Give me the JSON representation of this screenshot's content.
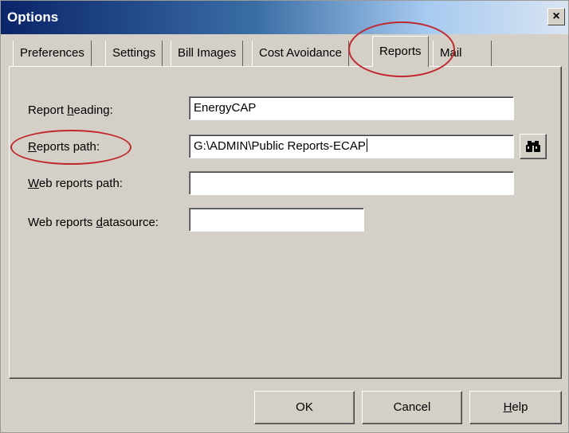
{
  "window": {
    "title": "Options",
    "close_glyph": "×"
  },
  "tabs": [
    {
      "label": "Preferences",
      "active": false
    },
    {
      "label": "Settings",
      "active": false
    },
    {
      "label": "Bill Images",
      "active": false
    },
    {
      "label": "Cost Avoidance",
      "active": false
    },
    {
      "label": "Reports",
      "active": true
    },
    {
      "label": "Mail",
      "active": false
    }
  ],
  "form": {
    "report_heading": {
      "label_pre": "Report ",
      "label_key": "h",
      "label_post": "eading:",
      "value": "EnergyCAP"
    },
    "reports_path": {
      "label_pre": "",
      "label_key": "R",
      "label_post": "eports path:",
      "value": "G:\\ADMIN\\Public Reports-ECAP",
      "browse_icon": "binoculars-icon"
    },
    "web_reports_path": {
      "label_pre": "",
      "label_key": "W",
      "label_post": "eb reports path:",
      "value": ""
    },
    "web_reports_datasource": {
      "label_pre": "Web reports ",
      "label_key": "d",
      "label_post": "atasource:",
      "value": ""
    }
  },
  "buttons": {
    "ok": "OK",
    "cancel": "Cancel",
    "help": {
      "label_key": "H",
      "label_post": "elp"
    }
  },
  "colors": {
    "highlight": "#c0282d",
    "title_bar": "#0a246a",
    "dialog_face": "#d4d0c8"
  }
}
